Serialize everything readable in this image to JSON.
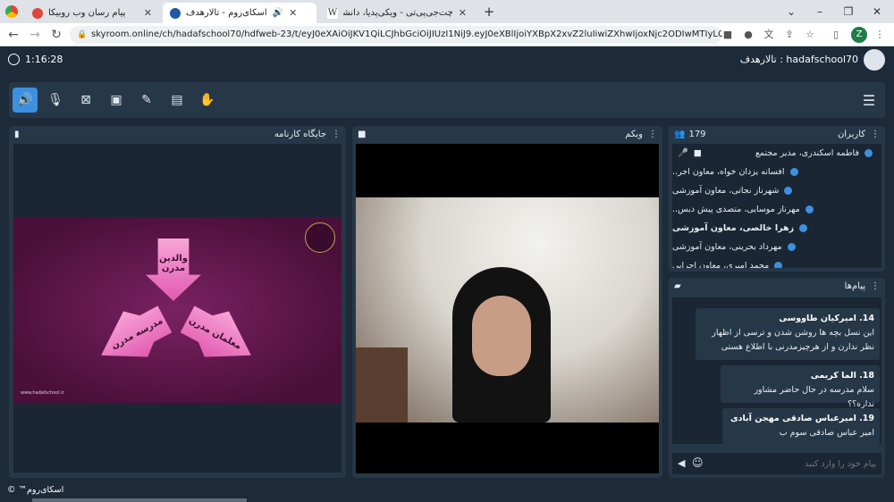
{
  "browser": {
    "tabs": [
      {
        "title": "پیام رسان وب روبیکا",
        "color": "#e0443e"
      },
      {
        "title": "اسکای‌روم - تالارهدف",
        "color": "#1c5aa8"
      },
      {
        "title": "چت‌جی‌پی‌تی - ویکی‌پدیا، دانشنامهٔ",
        "color": "#333333"
      }
    ],
    "url": "skyroom.online/ch/hadafschool70/hdfweb-23/t/eyJ0eXAiOiJKV1QiLCJhbGciOiJIUzI1NiJ9.eyJ0eXBlIjoiYXBpX2xvZ2luIiwiZXhwIjoxNjc2ODIwMTIyLCJyb29tX...",
    "profile_initial": "Z"
  },
  "topbar": {
    "timer": "1:16:28",
    "room_title": "hadafschool70 : تالارهدف"
  },
  "panels": {
    "board_title": "جایگاه کارنامه",
    "webcam_title": "وبکم",
    "users_title": "کاربران",
    "users_count": "179",
    "messages_title": "پیام‌ها",
    "message_placeholder": "پیام خود را وارد کنید"
  },
  "slide": {
    "top_arrow": "والدین\nمدرن",
    "left_arrow": "مدرسه مدرن",
    "right_arrow": "معلمان مدرن",
    "footer_url": "www.hadafschool.ir"
  },
  "users": [
    "فاطمه اسکندری، مدیر مجتمع",
    "افسانه یزدان خواه، معاون اجر..",
    "شهرناز نجاتی، معاون آموزشی",
    "مهرناز موسایی، متصدی پیش دبس..",
    "زهرا خالصی، معاون آموزشی",
    "مهرداد بحرینی، معاون آموزشی",
    "محمد امیری، معاون اجرایی"
  ],
  "messages": [
    {
      "name": "14. امیرکیان طاووسی",
      "text": "این نسل بچه ها روشن شدن و ترسی از اظهار نظر ندارن و از هرچیزمدرنی با اطلاع هستی"
    },
    {
      "name": "18. الما کریمی",
      "text": "سلام مدرسه در حال حاضر  مشاور نداره؟؟"
    },
    {
      "name": "19. امیرعباس صادقی مهجن آبادی",
      "text": "امیر عباس صادقی سوم ب"
    }
  ],
  "footer": {
    "brand": "اسکای‌روم™ ©"
  },
  "colors": {
    "accent": "#3d8fe0",
    "panel": "#263748",
    "background": "#1c2a3a",
    "slide": "#5a1446"
  }
}
